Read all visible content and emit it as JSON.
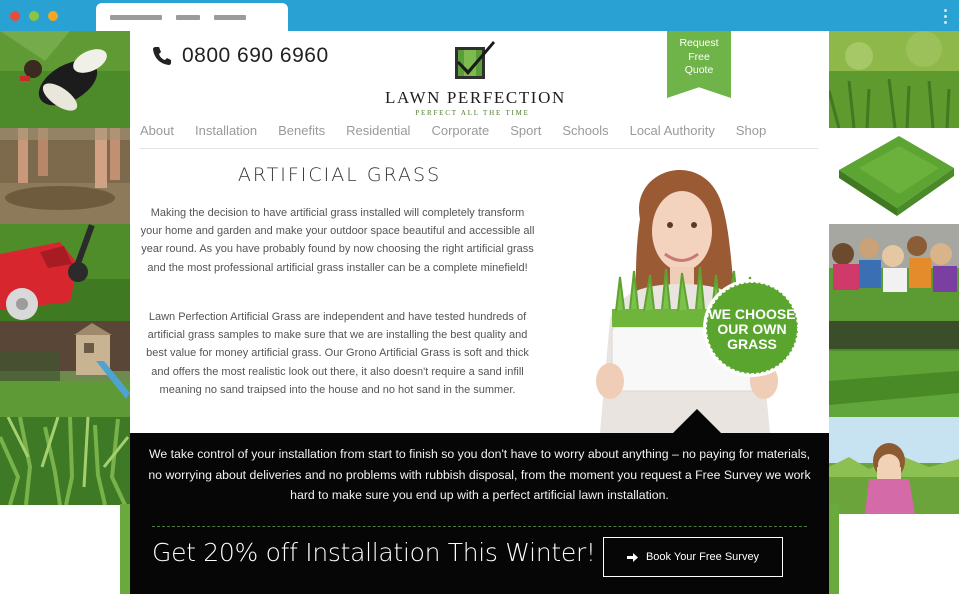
{
  "browser": {
    "dot_colors": [
      "#e64c3c",
      "#8cc63f",
      "#f5a623"
    ],
    "tab_bars": 3,
    "menu_icon": "vertical-dots-icon"
  },
  "header": {
    "phone_icon": "phone-icon",
    "phone": "0800 690 6960",
    "logo_icon": "green-checkbox-icon",
    "logo_name": "LAWN PERFECTION",
    "logo_tagline": "PERFECT ALL THE TIME",
    "quote_ribbon": [
      "Request",
      "Free",
      "Quote"
    ]
  },
  "nav": {
    "items": [
      "About",
      "Installation",
      "Benefits",
      "Residential",
      "Corporate",
      "Sport",
      "Schools",
      "Local Authority",
      "Shop"
    ]
  },
  "main": {
    "title": "ARTIFICIAL GRASS",
    "paragraph1": "Making the decision to have artificial grass installed will completely transform your home and garden and make your outdoor space beautiful and accessible all year round. As you have probably found by now choosing the right artificial grass and the most professional artificial grass installer can be a complete minefield!",
    "paragraph2": "Lawn Perfection Artificial Grass are independent and have tested hundreds of artificial grass samples to make sure that we are installing the best quality and best value for money artificial grass. Our Grono Artificial Grass is soft and thick and offers the most realistic look out there, it also doesn't require a sand infill meaning no sand traipsed into the house and no hot sand in the summer.",
    "badge_lines": [
      "WE CHOOSE",
      "OUR OWN",
      "GRASS"
    ]
  },
  "band": {
    "text": "We take control of your installation from start to finish so you don't have to worry about anything – no paying for materials, no worrying about deliveries and no problems with rubbish disposal, from the moment you request a Free Survey we work hard to make sure you end up with a perfect artificial lawn installation.",
    "promo": "Get 20% off Installation This Winter!",
    "button_icon": "arrow-right-icon",
    "button_label": "Book Your Free Survey"
  },
  "colors": {
    "brand_green": "#6fb449",
    "chrome_blue": "#2aa1d3",
    "band_black": "#060606"
  }
}
